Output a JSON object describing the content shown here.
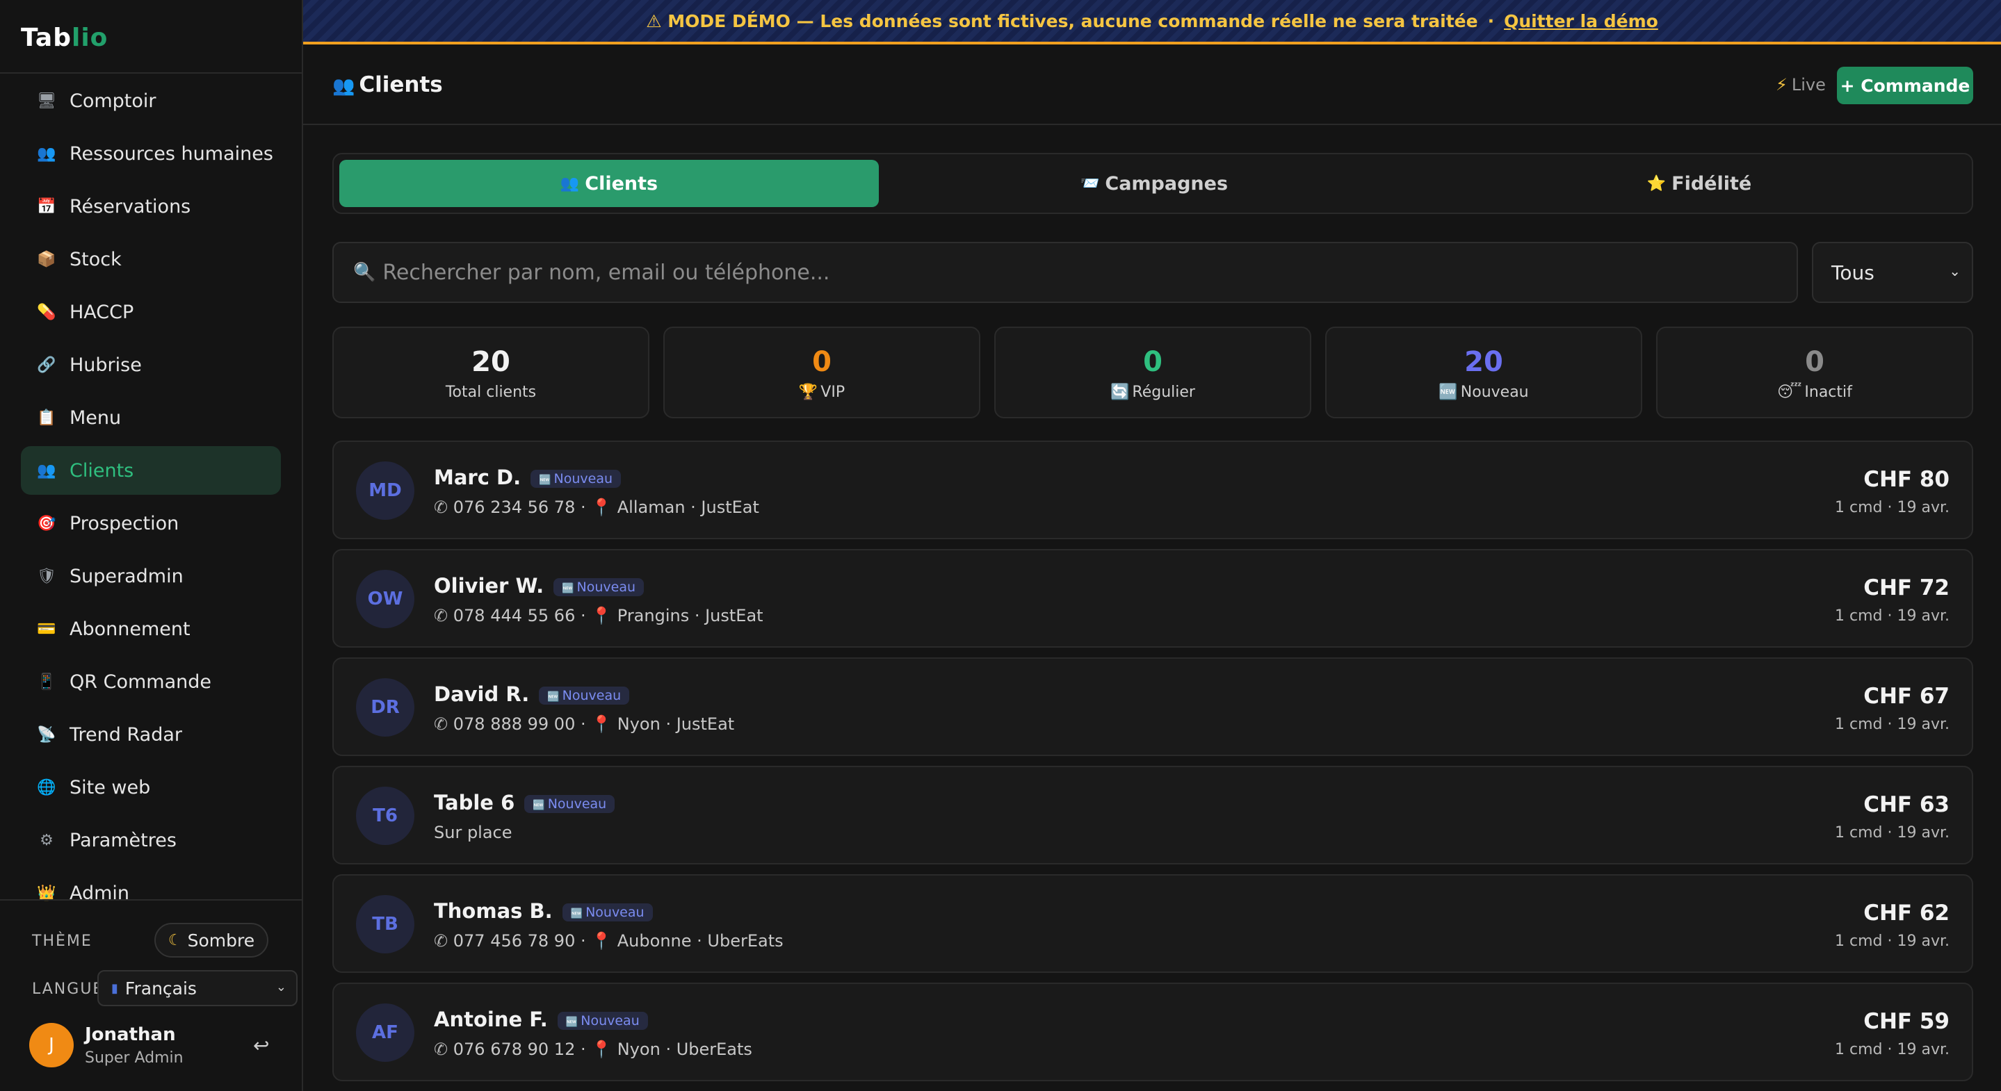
{
  "app": {
    "logo": {
      "part1": "Tab",
      "part2": "lio"
    }
  },
  "banner": {
    "icon": "warning-icon",
    "text": "⚠ MODE DÉMO — Les données sont fictives, aucune commande réelle ne sera traitée",
    "separator": "·",
    "quit_label": "Quitter la démo"
  },
  "sidebar": {
    "items": [
      {
        "label": "Comptoir",
        "icon": "monitor-icon",
        "glyph": "🖥"
      },
      {
        "label": "Ressources humaines",
        "icon": "people-icon",
        "glyph": "👥"
      },
      {
        "label": "Réservations",
        "icon": "calendar-icon",
        "glyph": "📅"
      },
      {
        "label": "Stock",
        "icon": "box-icon",
        "glyph": "📦"
      },
      {
        "label": "HACCP",
        "icon": "pill-icon",
        "glyph": "💊"
      },
      {
        "label": "Hubrise",
        "icon": "link-icon",
        "glyph": "🔗"
      },
      {
        "label": "Menu",
        "icon": "clipboard-icon",
        "glyph": "📋"
      },
      {
        "label": "Clients",
        "icon": "people-icon",
        "glyph": "👥",
        "active": true
      },
      {
        "label": "Prospection",
        "icon": "target-icon",
        "glyph": "🎯"
      },
      {
        "label": "Superadmin",
        "icon": "shield-icon",
        "glyph": "🛡"
      },
      {
        "label": "Abonnement",
        "icon": "credit-card-icon",
        "glyph": "💳"
      },
      {
        "label": "QR Commande",
        "icon": "phone-icon",
        "glyph": "📱"
      },
      {
        "label": "Trend Radar",
        "icon": "satellite-icon",
        "glyph": "📡"
      },
      {
        "label": "Site web",
        "icon": "globe-icon",
        "glyph": "🌐"
      },
      {
        "label": "Paramètres",
        "icon": "gear-icon",
        "glyph": "⚙"
      },
      {
        "label": "Admin",
        "icon": "crown-icon",
        "glyph": "👑"
      }
    ],
    "theme_label": "THÈME",
    "theme_value": "Sombre",
    "lang_label": "LANGUE",
    "lang_value": "Français",
    "user": {
      "initial": "J",
      "name": "Jonathan",
      "role": "Super Admin"
    }
  },
  "header": {
    "title": "Clients",
    "live_label": "Live",
    "new_order_label": "+ Commande"
  },
  "tabs": [
    {
      "label": "Clients",
      "icon": "people-icon",
      "glyph": "👥",
      "active": true
    },
    {
      "label": "Campagnes",
      "icon": "inbox-icon",
      "glyph": "📨"
    },
    {
      "label": "Fidélité",
      "icon": "star-icon",
      "glyph": "⭐"
    }
  ],
  "search": {
    "placeholder": "Rechercher par nom, email ou téléphone...",
    "filter_value": "Tous"
  },
  "stats": [
    {
      "value": "20",
      "label": "Total clients",
      "icon": "",
      "color": "#f2f2f2"
    },
    {
      "value": "0",
      "label": "VIP",
      "icon": "trophy-icon",
      "glyph": "🏆",
      "color": "#f08a14"
    },
    {
      "value": "0",
      "label": "Régulier",
      "icon": "refresh-icon",
      "glyph": "🔄",
      "color": "#2fbf7f"
    },
    {
      "value": "20",
      "label": "Nouveau",
      "icon": "new-icon",
      "glyph": "🆕",
      "color": "#6a6ff0"
    },
    {
      "value": "0",
      "label": "Inactif",
      "icon": "sleepy-icon",
      "glyph": "😴",
      "color": "#8a8a8a"
    }
  ],
  "clients": [
    {
      "initials": "MD",
      "name": "Marc D.",
      "badge": "Nouveau",
      "phone": "076 234 56 78",
      "location": "Allaman · JustEat",
      "amount": "CHF 80",
      "meta": "1 cmd · 19 avr."
    },
    {
      "initials": "OW",
      "name": "Olivier W.",
      "badge": "Nouveau",
      "phone": "078 444 55 66",
      "location": "Prangins · JustEat",
      "amount": "CHF 72",
      "meta": "1 cmd · 19 avr."
    },
    {
      "initials": "DR",
      "name": "David R.",
      "badge": "Nouveau",
      "phone": "078 888 99 00",
      "location": "Nyon · JustEat",
      "amount": "CHF 67",
      "meta": "1 cmd · 19 avr."
    },
    {
      "initials": "T6",
      "name": "Table 6",
      "badge": "Nouveau",
      "phone": "",
      "location": "Sur place",
      "amount": "CHF 63",
      "meta": "1 cmd · 19 avr."
    },
    {
      "initials": "TB",
      "name": "Thomas B.",
      "badge": "Nouveau",
      "phone": "077 456 78 90",
      "location": "Aubonne · UberEats",
      "amount": "CHF 62",
      "meta": "1 cmd · 19 avr."
    },
    {
      "initials": "AF",
      "name": "Antoine F.",
      "badge": "Nouveau",
      "phone": "076 678 90 12",
      "location": "Nyon · UberEats",
      "amount": "CHF 59",
      "meta": "1 cmd · 19 avr."
    }
  ]
}
